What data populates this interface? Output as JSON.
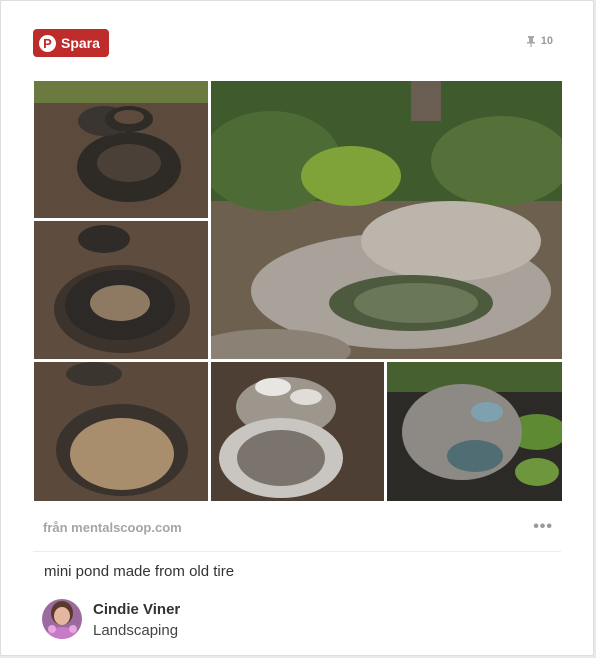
{
  "save_button": {
    "label": "Spara",
    "icon": "pinterest-p-icon",
    "color": "#bd2b2b"
  },
  "repin": {
    "icon": "pushpin-icon",
    "count": "10"
  },
  "collage": {
    "alt": "",
    "tiles": [
      "tires-on-ground",
      "tire-in-dug-hole",
      "finished-rock-pond",
      "tire-base-closeup",
      "rocks-around-liner",
      "pond-with-water"
    ]
  },
  "source": {
    "text": "från mentalscoop.com"
  },
  "more_menu": {
    "icon": "more-dots-icon",
    "text": "•••"
  },
  "pin": {
    "description": "mini pond made from old tire"
  },
  "author": {
    "name": "Cindie Viner",
    "board": "Landscaping",
    "avatar_icon": "avatar"
  }
}
